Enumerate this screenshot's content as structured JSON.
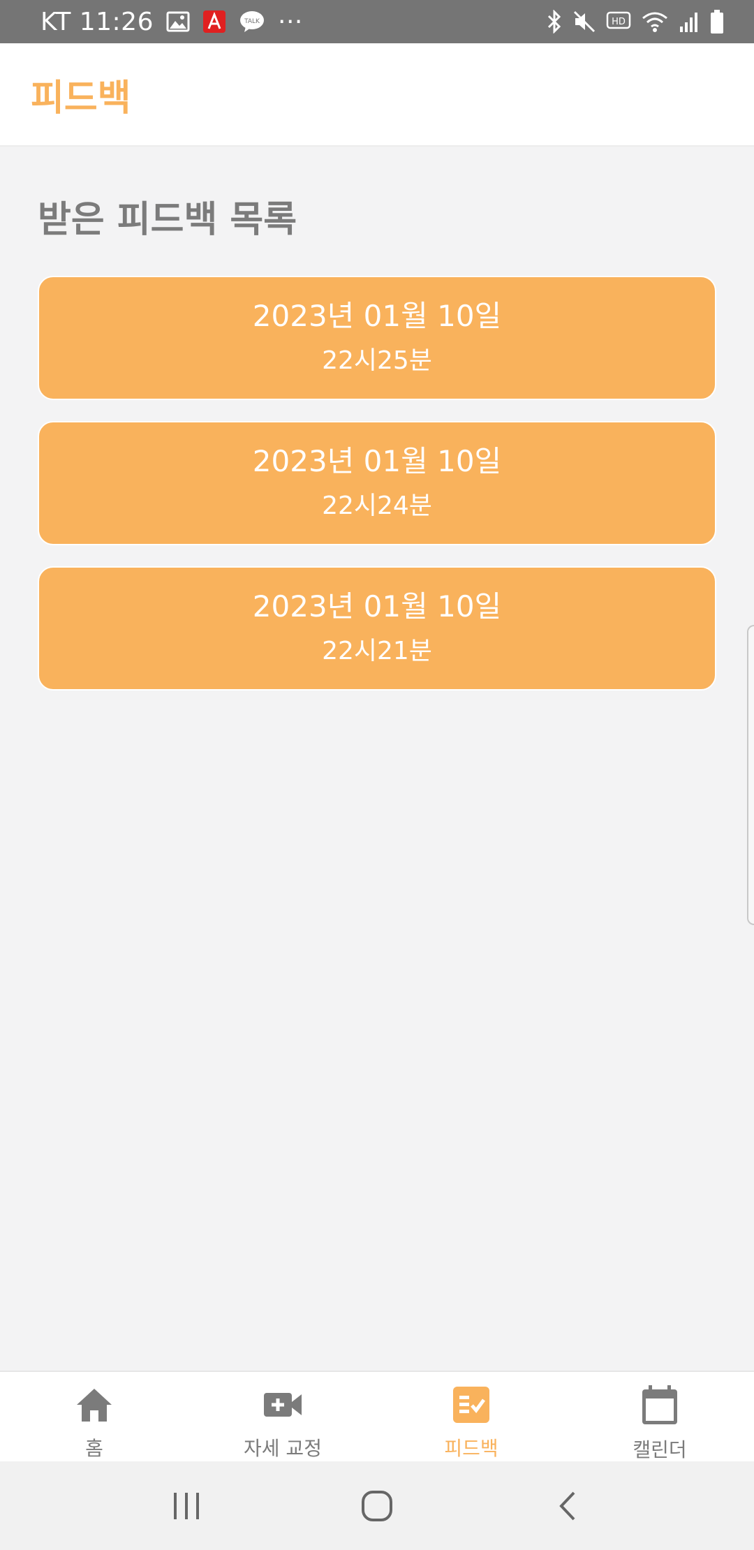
{
  "status_bar": {
    "carrier_time": "KT 11:26",
    "more_indicator": "···"
  },
  "app_bar": {
    "title": "피드백"
  },
  "section": {
    "title": "받은 피드백 목록"
  },
  "feedback_items": [
    {
      "date": "2023년 01월 10일",
      "time": "22시25분"
    },
    {
      "date": "2023년 01월 10일",
      "time": "22시24분"
    },
    {
      "date": "2023년 01월 10일",
      "time": "22시21분"
    }
  ],
  "bottom_nav": {
    "items": [
      {
        "label": "홈",
        "icon": "home-icon",
        "active": false
      },
      {
        "label": "자세 교정",
        "icon": "video-add-icon",
        "active": false
      },
      {
        "label": "피드백",
        "icon": "checklist-icon",
        "active": true
      },
      {
        "label": "캘린더",
        "icon": "calendar-icon",
        "active": false
      }
    ]
  },
  "system_nav": {
    "buttons": [
      "recent-apps-icon",
      "home-circle-icon",
      "back-icon"
    ]
  },
  "colors": {
    "accent": "#f9b25c",
    "inactive": "#7b7b7b",
    "status_bar": "#757575",
    "background": "#f3f3f4"
  }
}
